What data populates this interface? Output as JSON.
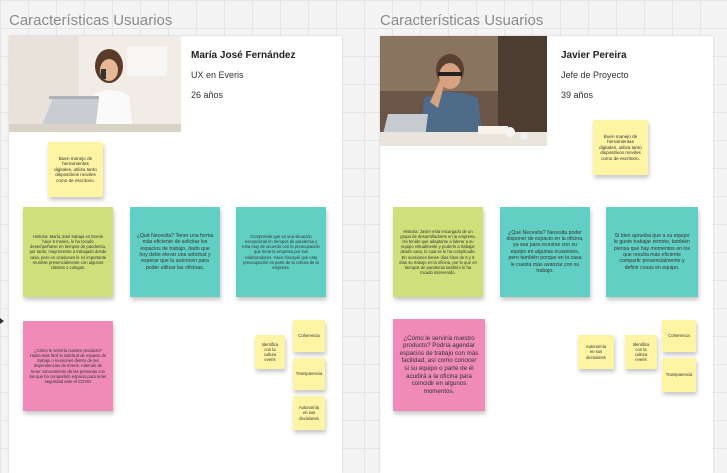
{
  "personas": [
    {
      "frame_title": "Características Usuarios",
      "name": "María José Fernández",
      "role": "UX en Everis",
      "age": "26 años",
      "stickies": {
        "tools": "Buen manejo de herramientas digitales, utiliza tanto dispositivos moviles como de escritorio.",
        "history": "Historia: María José trabaja en Everis hace 6 meses, le ha tocado desempeñarse en tiempos de pandemia, por tanto, mayormente a trabajado desde casa, pero en ocasiones le es importante reunirse presencialmente con algunos clientes o colegas.",
        "need": "¿Qué Necesita? Tener una forma más eficiente de solicitar los espacios de trabajo, dado que hoy debe elevar una solicitud y esperar que la autoricen para poder utilizar las oficinas.",
        "context": "Comprende que es una situación excepcional en tiempos de pandemia y esta muy de acuerdo con la preocupación que tiene la empresa por sus colaboradores. Hace hincapié que esta preocupación es parte de la cultura de la empresa.",
        "help": "¿Cómo le serviría nuestro producto? Hasta más fácil la solicitud de espacio de trabajo o reuniones dentro de las dependencias de Everis. Además de tener conocimiento de las personas con las que ha compartido espacio para tener seguridad ante el COVID",
        "culture": "Identifica con la cultura everis",
        "coherence": "Coherencia",
        "transparency": "Transparencia",
        "autonomy": "Autonomía en sus decisiones"
      }
    },
    {
      "frame_title": "Características Usuarios",
      "name": "Javier Pereira",
      "role": "Jefe de Proyecto",
      "age": "39 años",
      "stickies": {
        "tools": "Buen manejo de herramientas digitales, utiliza tanto dispositivos moviles como de escritorio.",
        "history": "Historia: Javier esta encargado de un grupo de desarrolladores en la empresa. Ha tenido que adaptarse a liderar a su equipo virtualmente y poderlo a trabajar desde casa, lo cual se le ha complicado. En ocasiones tienen días hitos de 5 y 6 días su trabajo en la oficina, por lo que en tiempos de pandemia también le ha tocado intervenido.",
        "need": "¿Qué Necesita? Necesita poder disponer de espacio en la oficina, ya sea para reunirse con su equipo en algunas ocasiones, pero también porque en la casa le cuesta más avanzar con su trabajo.",
        "context": "Si bien aprueba que a su equipo le guste trabajar remoto, también piensa que hay momentos en los que resulta más eficiente compartir presencialmente y definir cosas en equipo.",
        "help": "¿Cómo le serviría nuestro producto? Podría agendar espacios de trabajo con más facilidad, así como conocer si su equipo o parte de él acudirá a la oficina para coincidir en algunos momentos.",
        "autonomy": "Autonomía en sus decisiones",
        "culture": "Identifica con la cultura everis",
        "coherence": "Coherencia",
        "transparency": "Transparencia"
      }
    }
  ],
  "colors": {
    "green": "#cfe07a",
    "teal": "#62cfc4",
    "pink": "#ef8ab9",
    "yellow": "#fdf4a4",
    "frame_title": "#8a8a8a"
  }
}
